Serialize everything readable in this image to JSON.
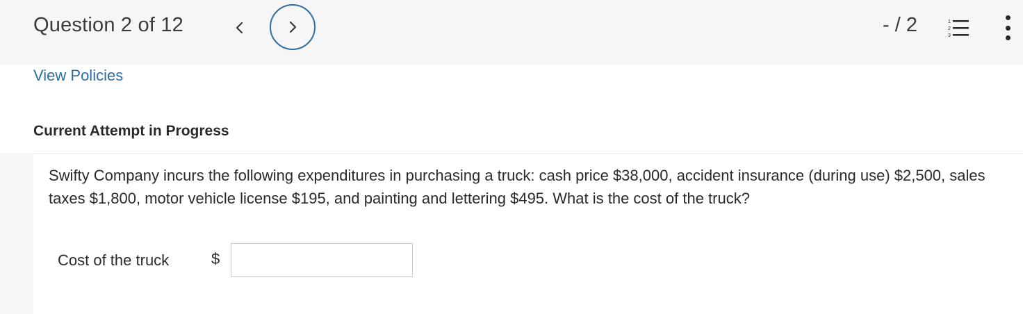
{
  "header": {
    "question_counter": "Question 2 of 12",
    "score": "- / 2",
    "prev_icon": "chevron-left-icon",
    "next_icon": "chevron-right-icon",
    "list_icon": "numbered-list-icon",
    "more_icon": "more-vertical-icon",
    "accent_color": "#2e6da4"
  },
  "links": {
    "view_policies": "View Policies"
  },
  "section": {
    "heading": "Current Attempt in Progress"
  },
  "question": {
    "text": "Swifty Company incurs the following expenditures in purchasing a truck: cash price $38,000, accident insurance (during use) $2,500, sales taxes $1,800, motor vehicle license $195, and painting and lettering $495. What is the cost of the truck?"
  },
  "answer": {
    "label": "Cost of the truck",
    "currency": "$",
    "value": ""
  }
}
